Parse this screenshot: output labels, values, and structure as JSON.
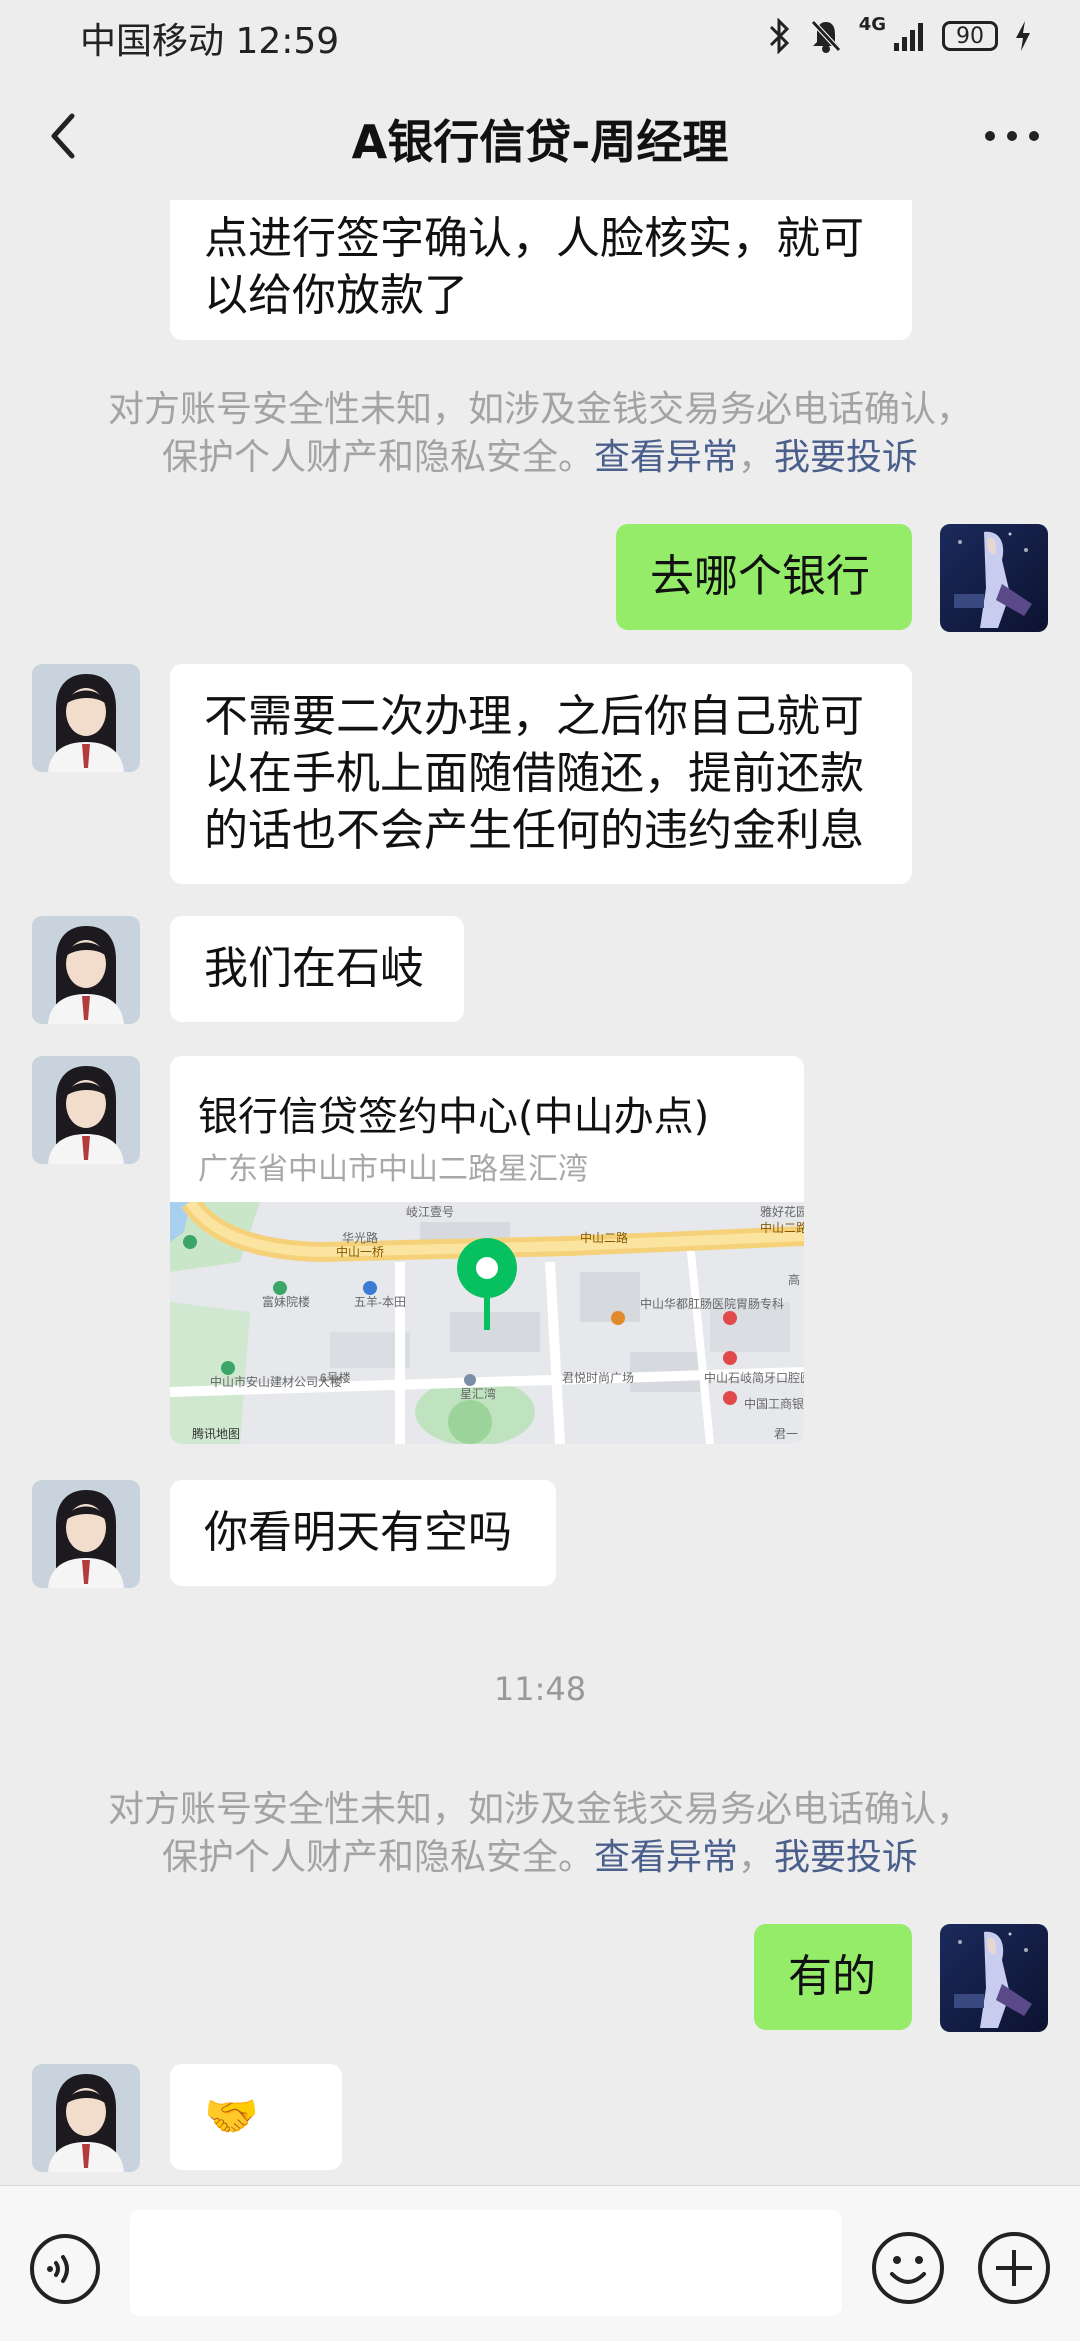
{
  "status_bar": {
    "carrier": "中国移动",
    "time": "12:59",
    "network": "4G",
    "battery": "90"
  },
  "header": {
    "title": "A银行信贷-周经理"
  },
  "messages": [
    {
      "side": "left",
      "lines": [
        "点进行签字确认，人脸核实，就可",
        "以给你放款了"
      ]
    },
    {
      "type": "notice",
      "text": "对方账号安全性未知，如涉及金钱交易务必电话确认，",
      "text2": "保护个人财产和隐私安全。",
      "link1": "查看异常",
      "sep": "，",
      "link2": "我要投诉"
    },
    {
      "side": "right",
      "text": "去哪个银行"
    },
    {
      "side": "left",
      "lines": [
        "不需要二次办理，之后你自己就可",
        "以在手机上面随借随还，提前还款",
        "的话也不会产生任何的违约金利息"
      ]
    },
    {
      "side": "left",
      "text": "我们在石岐"
    },
    {
      "type": "location",
      "title": "银行信贷签约中心(中山办点)",
      "address": "广东省中山市中山二路星汇湾",
      "map_labels": [
        "岐江壹号",
        "雅好花园",
        "华光路",
        "中山二路",
        "中山一桥",
        "中山二路",
        "富妹院楼",
        "五羊-本田",
        "中山华都肛肠医院胃肠专科",
        "中山市安山建材公司大楼",
        "6号楼",
        "星汇湾",
        "君悦时尚广场",
        "中山石岐简牙口腔医院",
        "中国工商银",
        "腾讯地图",
        "高",
        "君一"
      ]
    },
    {
      "side": "left",
      "text": "你看明天有空吗"
    },
    {
      "type": "time",
      "text": "11:48"
    },
    {
      "type": "notice",
      "text": "对方账号安全性未知，如涉及金钱交易务必电话确认，",
      "text2": "保护个人财产和隐私安全。",
      "link1": "查看异常",
      "sep": "，",
      "link2": "我要投诉"
    },
    {
      "side": "right",
      "text": "有的"
    },
    {
      "side": "left",
      "text": "🤝🤝"
    }
  ],
  "colors": {
    "background": "#ededed",
    "my_bubble": "#95ec69",
    "their_bubble": "#ffffff",
    "notice_link": "#4a5f8c",
    "map_pin": "#07c160"
  },
  "icons": [
    "back-icon",
    "more-icon",
    "voice-icon",
    "emoji-icon",
    "plus-icon",
    "bluetooth-icon",
    "mute-icon",
    "signal-icon",
    "charging-icon",
    "map-pin-icon"
  ]
}
